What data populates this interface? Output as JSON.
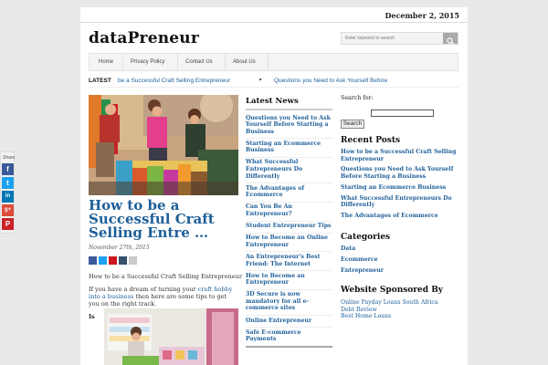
{
  "header": {
    "date": "December 2, 2015",
    "site_title": "dataPreneur",
    "search_placeholder": "Enter keyword to search"
  },
  "nav": {
    "items": [
      "Home",
      "Privacy Policy",
      "Contact Us",
      "About Us"
    ]
  },
  "latest": {
    "label": "LATEST",
    "ticker": [
      "be a Successful Craft Selling Entrepreneur",
      "Questions you Need to Ask Yourself Before"
    ]
  },
  "post": {
    "title": "How to be a Successful Craft Selling Entre …",
    "date": "November 27th, 2015",
    "excerpt_title": "How to be a Successful Craft Selling Entrepreneur",
    "excerpt_part1": "If you have a dream of turning your ",
    "excerpt_link": "craft hobby into a business",
    "excerpt_part2": " then here are some tips to get you on the right track.",
    "is_word": "Is"
  },
  "latest_news": {
    "heading": "Latest News",
    "items": [
      "Questions you Need to Ask Yourself Before Starting a Business",
      "Starting an Ecommerce Business",
      "What Successful Entrepreneurs Do Differently",
      "The Advantages of Ecommerce",
      "Can You Be An Entrepreneur?",
      "Student Entrepreneur Tips",
      "How to Become an Online Entrepreneur",
      "An Entrepreneur's Best Friend: The Internet",
      "How to Become an Entrepreneur",
      "3D Secure is now mandatory for all e-commerce sites",
      "Online Entrepreneur",
      "Safe E-commerce Payments"
    ]
  },
  "sidebar": {
    "search_label": "Search for:",
    "search_button": "Search",
    "recent_heading": "Recent Posts",
    "recent": [
      "How to be a Successful Craft Selling Entrepreneur",
      "Questions you Need to Ask Yourself Before Starting a Business",
      "Starting an Ecommerce Business",
      "What Successful Entrepreneurs Do Differently",
      "The Advantages of Ecommerce"
    ],
    "categories_heading": "Categories",
    "categories": [
      "Data",
      "Ecommerce",
      "Entrepreneur"
    ],
    "sponsored_heading": "Website Sponsored By",
    "sponsored": [
      "Online Payday Loans South Africa",
      "Debt Review",
      "Best Home Loans"
    ]
  },
  "share_sidebar": {
    "label": "Share",
    "icons": [
      {
        "name": "facebook-icon",
        "glyph": "f",
        "color": "#3b5998"
      },
      {
        "name": "twitter-icon",
        "glyph": "t",
        "color": "#1da1f2"
      },
      {
        "name": "linkedin-icon",
        "glyph": "in",
        "color": "#0077b5"
      },
      {
        "name": "googleplus-icon",
        "glyph": "g+",
        "color": "#dd4b39"
      },
      {
        "name": "pinterest-icon",
        "glyph": "P",
        "color": "#cb2027"
      }
    ]
  },
  "colors": {
    "link": "#1e5f99",
    "background": "#e9e9e9"
  }
}
